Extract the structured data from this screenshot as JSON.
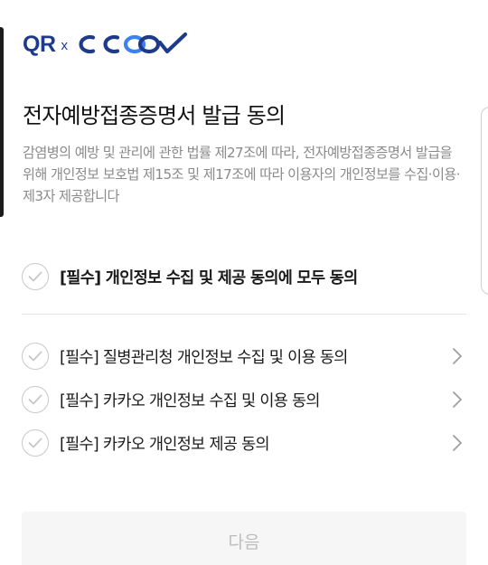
{
  "logo": {
    "qr_text": "QR",
    "x_text": "x",
    "brand_text": "COOV",
    "brand_color": "#1e3a8a",
    "accent_color": "#3b82f6"
  },
  "consent": {
    "title": "전자예방접종증명서 발급 동의",
    "description": "감염병의 예방 및 관리에 관한 법률 제27조에 따라, 전자예방접종증명서 발급을 위해 개인정보 보호법 제15조 및 제17조에 따라 이용자의 개인정보를 수집·이용·제3자 제공합니다",
    "agree_all": {
      "label": "[필수] 개인정보 수집 및 제공 동의에 모두 동의",
      "checked": false,
      "icon": "check-circle-icon"
    },
    "items": [
      {
        "label": "[필수] 질병관리청 개인정보 수집 및 이용 동의",
        "checked": false,
        "icon": "check-circle-icon",
        "detail_icon": "chevron-right-icon"
      },
      {
        "label": "[필수] 카카오 개인정보 수집 및 이용 동의",
        "checked": false,
        "icon": "check-circle-icon",
        "detail_icon": "chevron-right-icon"
      },
      {
        "label": "[필수] 카카오 개인정보 제공 동의",
        "checked": false,
        "icon": "check-circle-icon",
        "detail_icon": "chevron-right-icon"
      }
    ]
  },
  "next_button": {
    "label": "다음",
    "enabled": false
  },
  "colors": {
    "check_gray": "#c8c8c8",
    "disabled_bg": "#f6f6f6",
    "disabled_text": "#bdbdbd"
  }
}
